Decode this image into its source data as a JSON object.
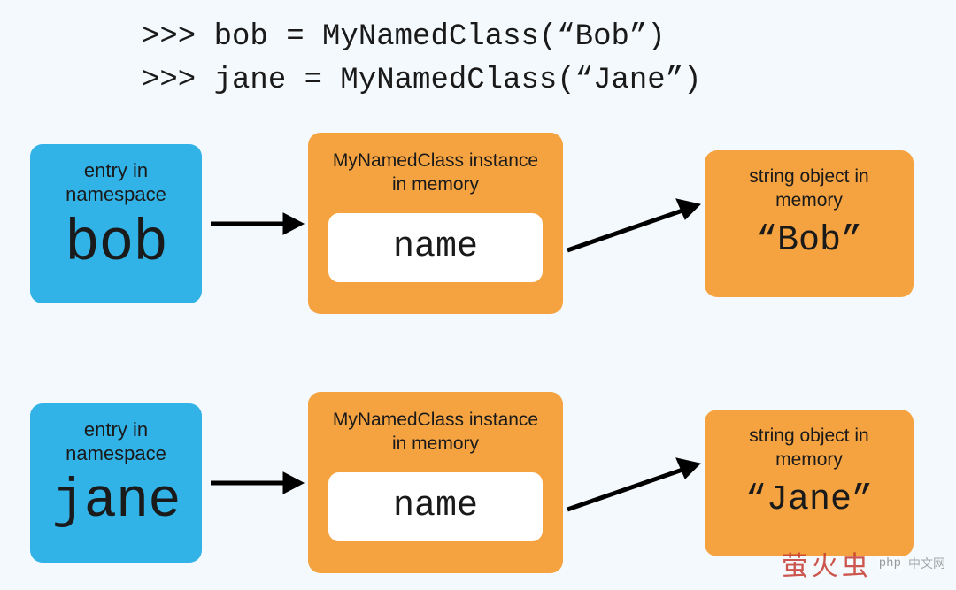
{
  "code": {
    "line1": ">>> bob = MyNamedClass(“Bob”)",
    "line2": ">>> jane = MyNamedClass(“Jane”)"
  },
  "labels": {
    "ns_caption": "entry in namespace",
    "inst_caption": "MyNamedClass instance in memory",
    "attr_label": "name",
    "str_caption": "string object in memory"
  },
  "rows": [
    {
      "var": "bob",
      "value": "“Bob”"
    },
    {
      "var": "jane",
      "value": "“Jane”"
    }
  ],
  "watermark": {
    "cn": "萤火虫",
    "php": "php",
    "suffix": "中文网"
  },
  "colors": {
    "bg": "#f3f9fc",
    "blue": "#32b3e7",
    "orange": "#f5a340",
    "white": "#ffffff"
  },
  "chart_data": {
    "type": "diagram",
    "title": "Python object instantiation and naming",
    "code_lines": [
      ">>> bob = MyNamedClass(\"Bob\")",
      ">>> jane = MyNamedClass(\"Jane\")"
    ],
    "nodes": [
      {
        "id": "ns_bob",
        "kind": "namespace-entry",
        "label": "bob",
        "color": "blue"
      },
      {
        "id": "inst_bob",
        "kind": "MyNamedClass-instance",
        "attr": "name",
        "color": "orange"
      },
      {
        "id": "str_bob",
        "kind": "string-object",
        "value": "Bob",
        "color": "orange"
      },
      {
        "id": "ns_jane",
        "kind": "namespace-entry",
        "label": "jane",
        "color": "blue"
      },
      {
        "id": "inst_jane",
        "kind": "MyNamedClass-instance",
        "attr": "name",
        "color": "orange"
      },
      {
        "id": "str_jane",
        "kind": "string-object",
        "value": "Jane",
        "color": "orange"
      }
    ],
    "edges": [
      {
        "from": "ns_bob",
        "to": "inst_bob"
      },
      {
        "from": "inst_bob",
        "to": "str_bob"
      },
      {
        "from": "ns_jane",
        "to": "inst_jane"
      },
      {
        "from": "inst_jane",
        "to": "str_jane"
      }
    ]
  }
}
